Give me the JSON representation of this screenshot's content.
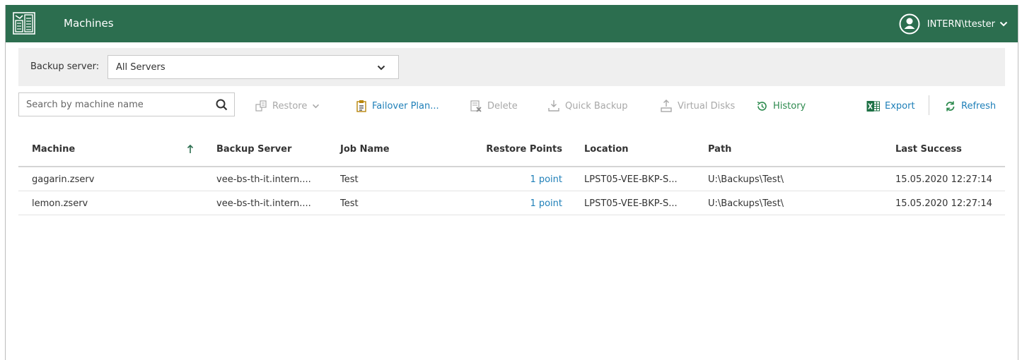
{
  "header": {
    "title": "Machines",
    "user": "INTERN\\ttester"
  },
  "filter": {
    "label": "Backup server:",
    "selected": "All Servers"
  },
  "search": {
    "placeholder": "Search by machine name"
  },
  "toolbar": {
    "restore": "Restore",
    "failover_plan": "Failover Plan...",
    "delete": "Delete",
    "quick_backup": "Quick Backup",
    "virtual_disks": "Virtual Disks",
    "history": "History",
    "export": "Export",
    "refresh": "Refresh"
  },
  "table": {
    "columns": {
      "machine": "Machine",
      "backup_server": "Backup Server",
      "job_name": "Job Name",
      "restore_points": "Restore Points",
      "location": "Location",
      "path": "Path",
      "last_success": "Last Success"
    },
    "rows": [
      {
        "machine": "gagarin.zserv",
        "backup_server": "vee-bs-th-it.intern....",
        "job_name": "Test",
        "restore_points": "1 point",
        "location": "LPST05-VEE-BKP-S...",
        "path": "U:\\Backups\\Test\\",
        "last_success": "15.05.2020 12:27:14"
      },
      {
        "machine": "lemon.zserv",
        "backup_server": "vee-bs-th-it.intern....",
        "job_name": "Test",
        "restore_points": "1 point",
        "location": "LPST05-VEE-BKP-S...",
        "path": "U:\\Backups\\Test\\",
        "last_success": "15.05.2020 12:27:14"
      }
    ]
  },
  "colors": {
    "header_bg": "#2c6e4f",
    "link": "#1e7fb8",
    "green_action": "#2d8a4e",
    "disabled": "#a8a8a8"
  }
}
